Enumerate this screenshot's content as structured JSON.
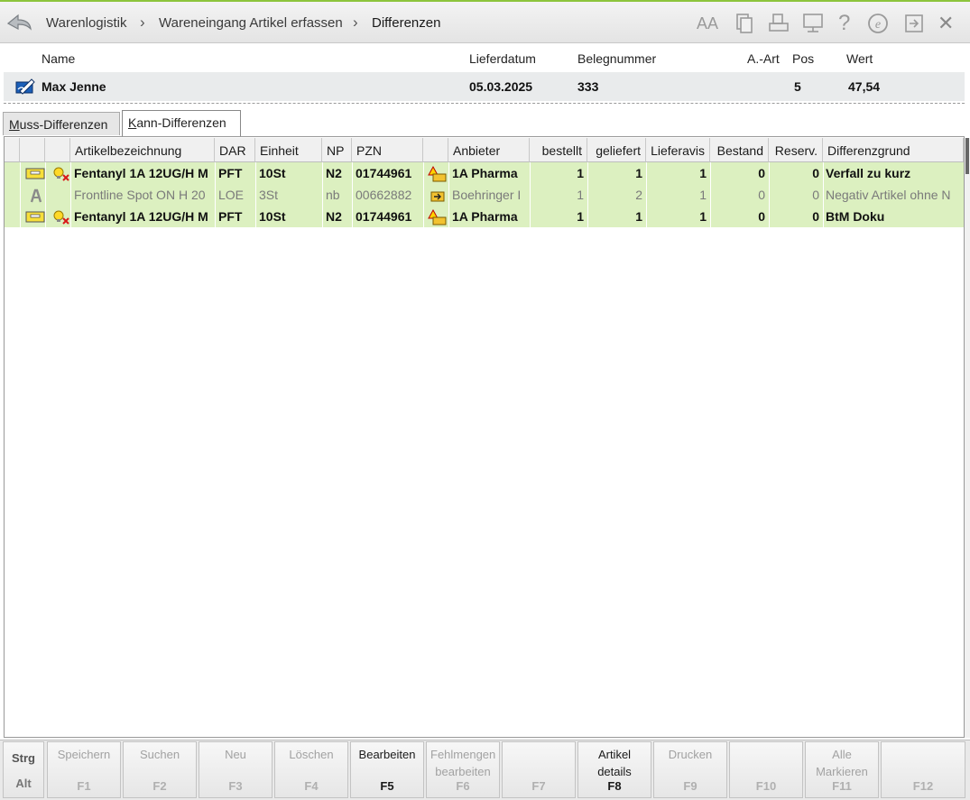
{
  "breadcrumb": {
    "items": [
      "Warenlogistik",
      "Wareneingang Artikel erfassen",
      "Differenzen"
    ],
    "separator": "›"
  },
  "toolbar": {
    "font_size_label": "AA",
    "help_label": "?",
    "close_label": "✕",
    "e_label": "e"
  },
  "header": {
    "labels": {
      "name": "Name",
      "lieferdatum": "Lieferdatum",
      "belegnummer": "Belegnummer",
      "a_art": "A.-Art",
      "pos": "Pos",
      "wert": "Wert"
    },
    "values": {
      "name": "Max Jenne",
      "lieferdatum": "05.03.2025",
      "belegnummer": "333",
      "a_art": "",
      "pos": "5",
      "wert": "47,54"
    }
  },
  "tabs": {
    "muss_first": "M",
    "muss_rest": "uss-Differenzen",
    "kann_first": "K",
    "kann_rest": "ann-Differenzen"
  },
  "table": {
    "columns": [
      "Artikelbezeichnung",
      "DAR",
      "Einheit",
      "NP",
      "PZN",
      "Anbieter",
      "bestellt",
      "geliefert",
      "Lieferavis",
      "Bestand",
      "Reserv.",
      "Differenzgrund"
    ],
    "rows": [
      {
        "artikel": "Fentanyl 1A 12UG/H M",
        "dar": "PFT",
        "einheit": "10St",
        "np": "N2",
        "pzn": "01744961",
        "anbieter": "1A Pharma",
        "bestellt": "1",
        "geliefert": "1",
        "lieferavis": "1",
        "bestand": "0",
        "reserv": "0",
        "grund": "Verfall zu kurz"
      },
      {
        "artikel": "Frontline Spot ON H 20",
        "dar": "LOE",
        "einheit": "3St",
        "np": "nb",
        "pzn": "00662882",
        "anbieter": "Boehringer I",
        "bestellt": "1",
        "geliefert": "2",
        "lieferavis": "1",
        "bestand": "0",
        "reserv": "0",
        "grund": "Negativ Artikel ohne N"
      },
      {
        "artikel": "Fentanyl 1A 12UG/H M",
        "dar": "PFT",
        "einheit": "10St",
        "np": "N2",
        "pzn": "01744961",
        "anbieter": "1A Pharma",
        "bestellt": "1",
        "geliefert": "1",
        "lieferavis": "1",
        "bestand": "0",
        "reserv": "0",
        "grund": "BtM Doku"
      }
    ]
  },
  "fkeys": {
    "mod_strg": "Strg",
    "mod_alt": "Alt",
    "f1": {
      "label": "Speichern",
      "key": "F1"
    },
    "f2": {
      "label": "Suchen",
      "key": "F2"
    },
    "f3": {
      "label": "Neu",
      "key": "F3"
    },
    "f4": {
      "label": "Löschen",
      "key": "F4"
    },
    "f5": {
      "label": "Bearbeiten",
      "key": "F5"
    },
    "f6": {
      "label": "Fehlmengen bearbeiten",
      "key": "F6"
    },
    "f7": {
      "label": "",
      "key": "F7"
    },
    "f8": {
      "label": "Artikel details",
      "key": "F8"
    },
    "f9": {
      "label": "Drucken",
      "key": "F9"
    },
    "f10": {
      "label": "",
      "key": "F10"
    },
    "f11": {
      "label": "Alle Markieren",
      "key": "F11"
    },
    "f12": {
      "label": "",
      "key": "F12"
    }
  },
  "colors": {
    "accent_green": "#8cc43c",
    "row_highlight": "#dcf0c0",
    "info_bg": "#e9ebec"
  }
}
